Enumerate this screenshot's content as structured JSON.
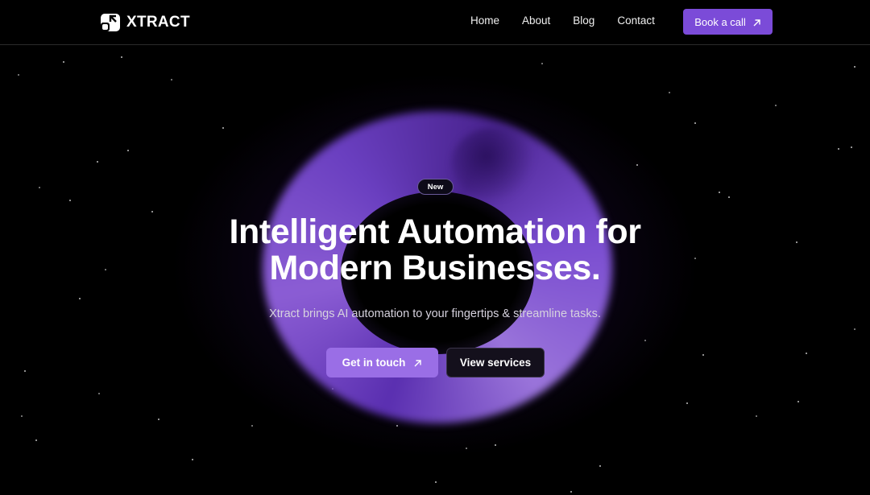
{
  "brand": {
    "name": "XTRACT",
    "accent": "#7b4bd8"
  },
  "nav": {
    "links": [
      "Home",
      "About",
      "Blog",
      "Contact"
    ],
    "cta_label": "Book a call",
    "cta_icon": "arrow-up-right-icon"
  },
  "hero": {
    "badge": "New",
    "headline_line1": "Intelligent Automation for",
    "headline_line2": "Modern Businesses.",
    "subheadline": "Xtract brings AI automation to your fingertips & streamline tasks.",
    "primary_cta": "Get in touch",
    "primary_cta_icon": "arrow-up-right-icon",
    "secondary_cta": "View services"
  },
  "colors": {
    "background": "#000000",
    "primary_button": "#9a6ee6",
    "orb": "#7a4dd0"
  }
}
